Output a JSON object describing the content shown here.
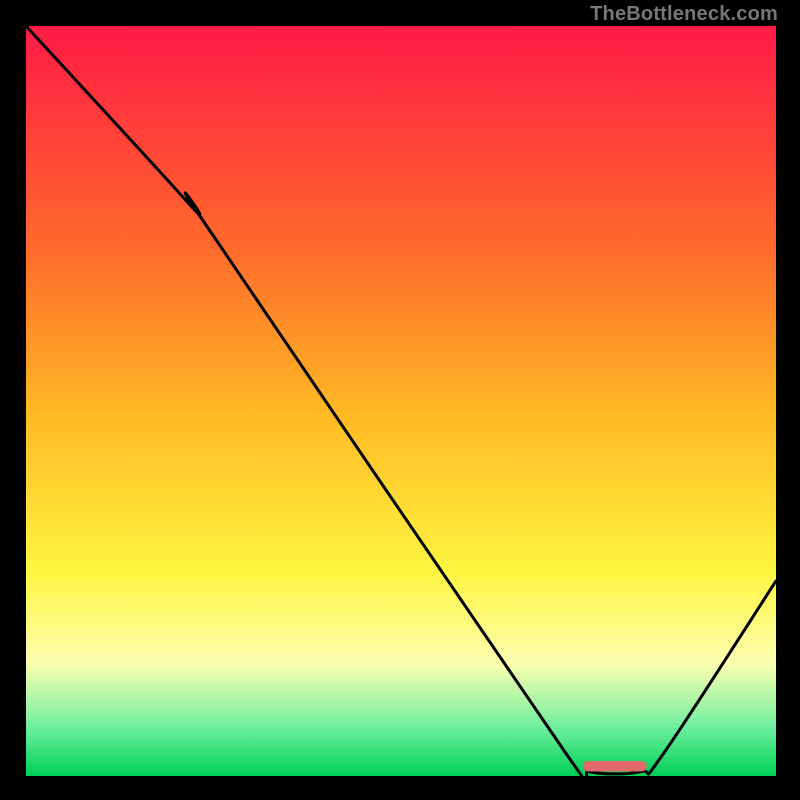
{
  "attribution": "TheBottleneck.com",
  "colors": {
    "top": "#ff1a46",
    "midA": "#ff6b2b",
    "midB": "#ffba24",
    "midC": "#fff642",
    "paleYellow": "#fdffb0",
    "softGreen": "#6eef9e",
    "green": "#00d056",
    "lineBlack": "#000000",
    "marker": "#e06a6a",
    "frame": "#000000",
    "attribution": "#777777"
  },
  "chart_data": {
    "type": "line",
    "title": "",
    "xlabel": "",
    "ylabel": "",
    "xlim": [
      0,
      100
    ],
    "ylim": [
      0,
      100
    ],
    "curve": [
      {
        "x": 0,
        "y": 100
      },
      {
        "x": 22,
        "y": 76
      },
      {
        "x": 25,
        "y": 72
      },
      {
        "x": 72,
        "y": 3
      },
      {
        "x": 75,
        "y": 0.6
      },
      {
        "x": 82,
        "y": 0.6
      },
      {
        "x": 85,
        "y": 3
      },
      {
        "x": 100,
        "y": 26
      }
    ],
    "marker": {
      "x_center": 78.5,
      "y": 1.3,
      "width": 8.5,
      "height": 1.4
    },
    "gradient_stops": [
      {
        "pct": 0,
        "key": "top"
      },
      {
        "pct": 30,
        "key": "midA"
      },
      {
        "pct": 52,
        "key": "midB"
      },
      {
        "pct": 73,
        "key": "midC"
      },
      {
        "pct": 85,
        "key": "paleYellow"
      },
      {
        "pct": 93.5,
        "key": "softGreen"
      },
      {
        "pct": 100,
        "key": "green"
      }
    ]
  }
}
